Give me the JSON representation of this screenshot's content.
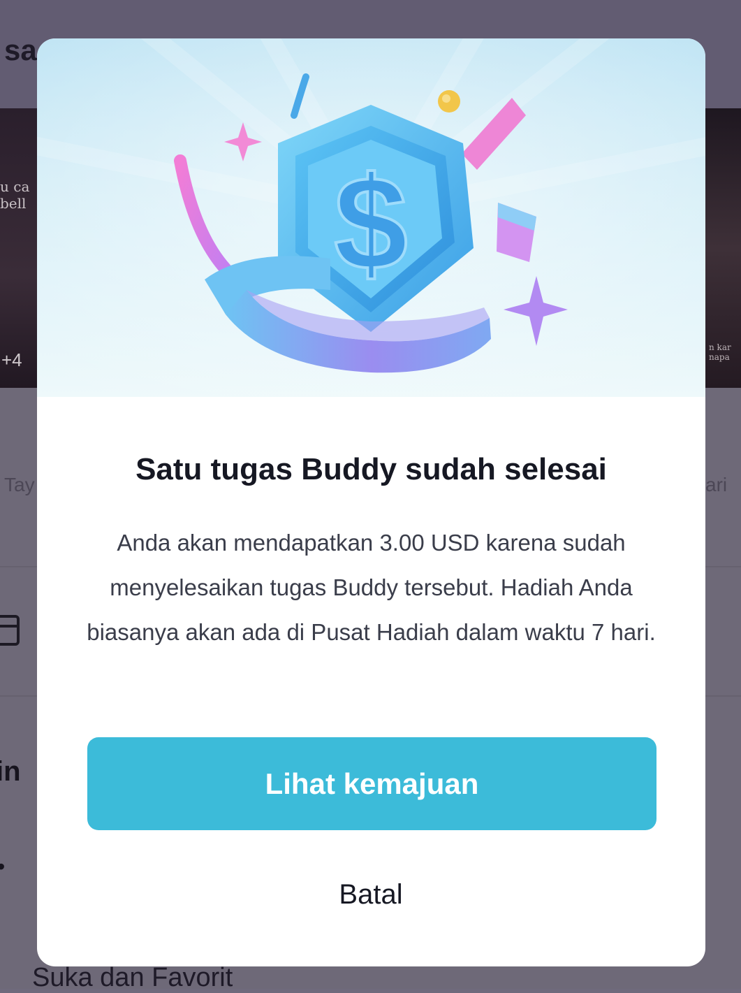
{
  "background": {
    "header_text": "sa",
    "media_left_caption": "u ca\nbell",
    "media_left_count": "+4",
    "media_right_caption": "n kar\nnapa",
    "tab_left_partial": "Tay",
    "tab_right_partial": "ari",
    "section_partial": "in",
    "bullet_partial": "•",
    "bottom_label": "Suka dan Favorit"
  },
  "modal": {
    "hero_icon": "dollar-shield-icon",
    "title": "Satu tugas Buddy sudah selesai",
    "description": "Anda akan mendapatkan 3.00 USD karena sudah menyelesaikan tugas Buddy tersebut. Hadiah Anda biasanya akan ada di Pusat Hadiah dalam waktu 7 hari.",
    "primary_button_label": "Lihat kemajuan",
    "cancel_button_label": "Batal"
  },
  "colors": {
    "primary_button": "#3cbbd9",
    "title_text": "#161823",
    "overlay": "#6f6a7c"
  }
}
